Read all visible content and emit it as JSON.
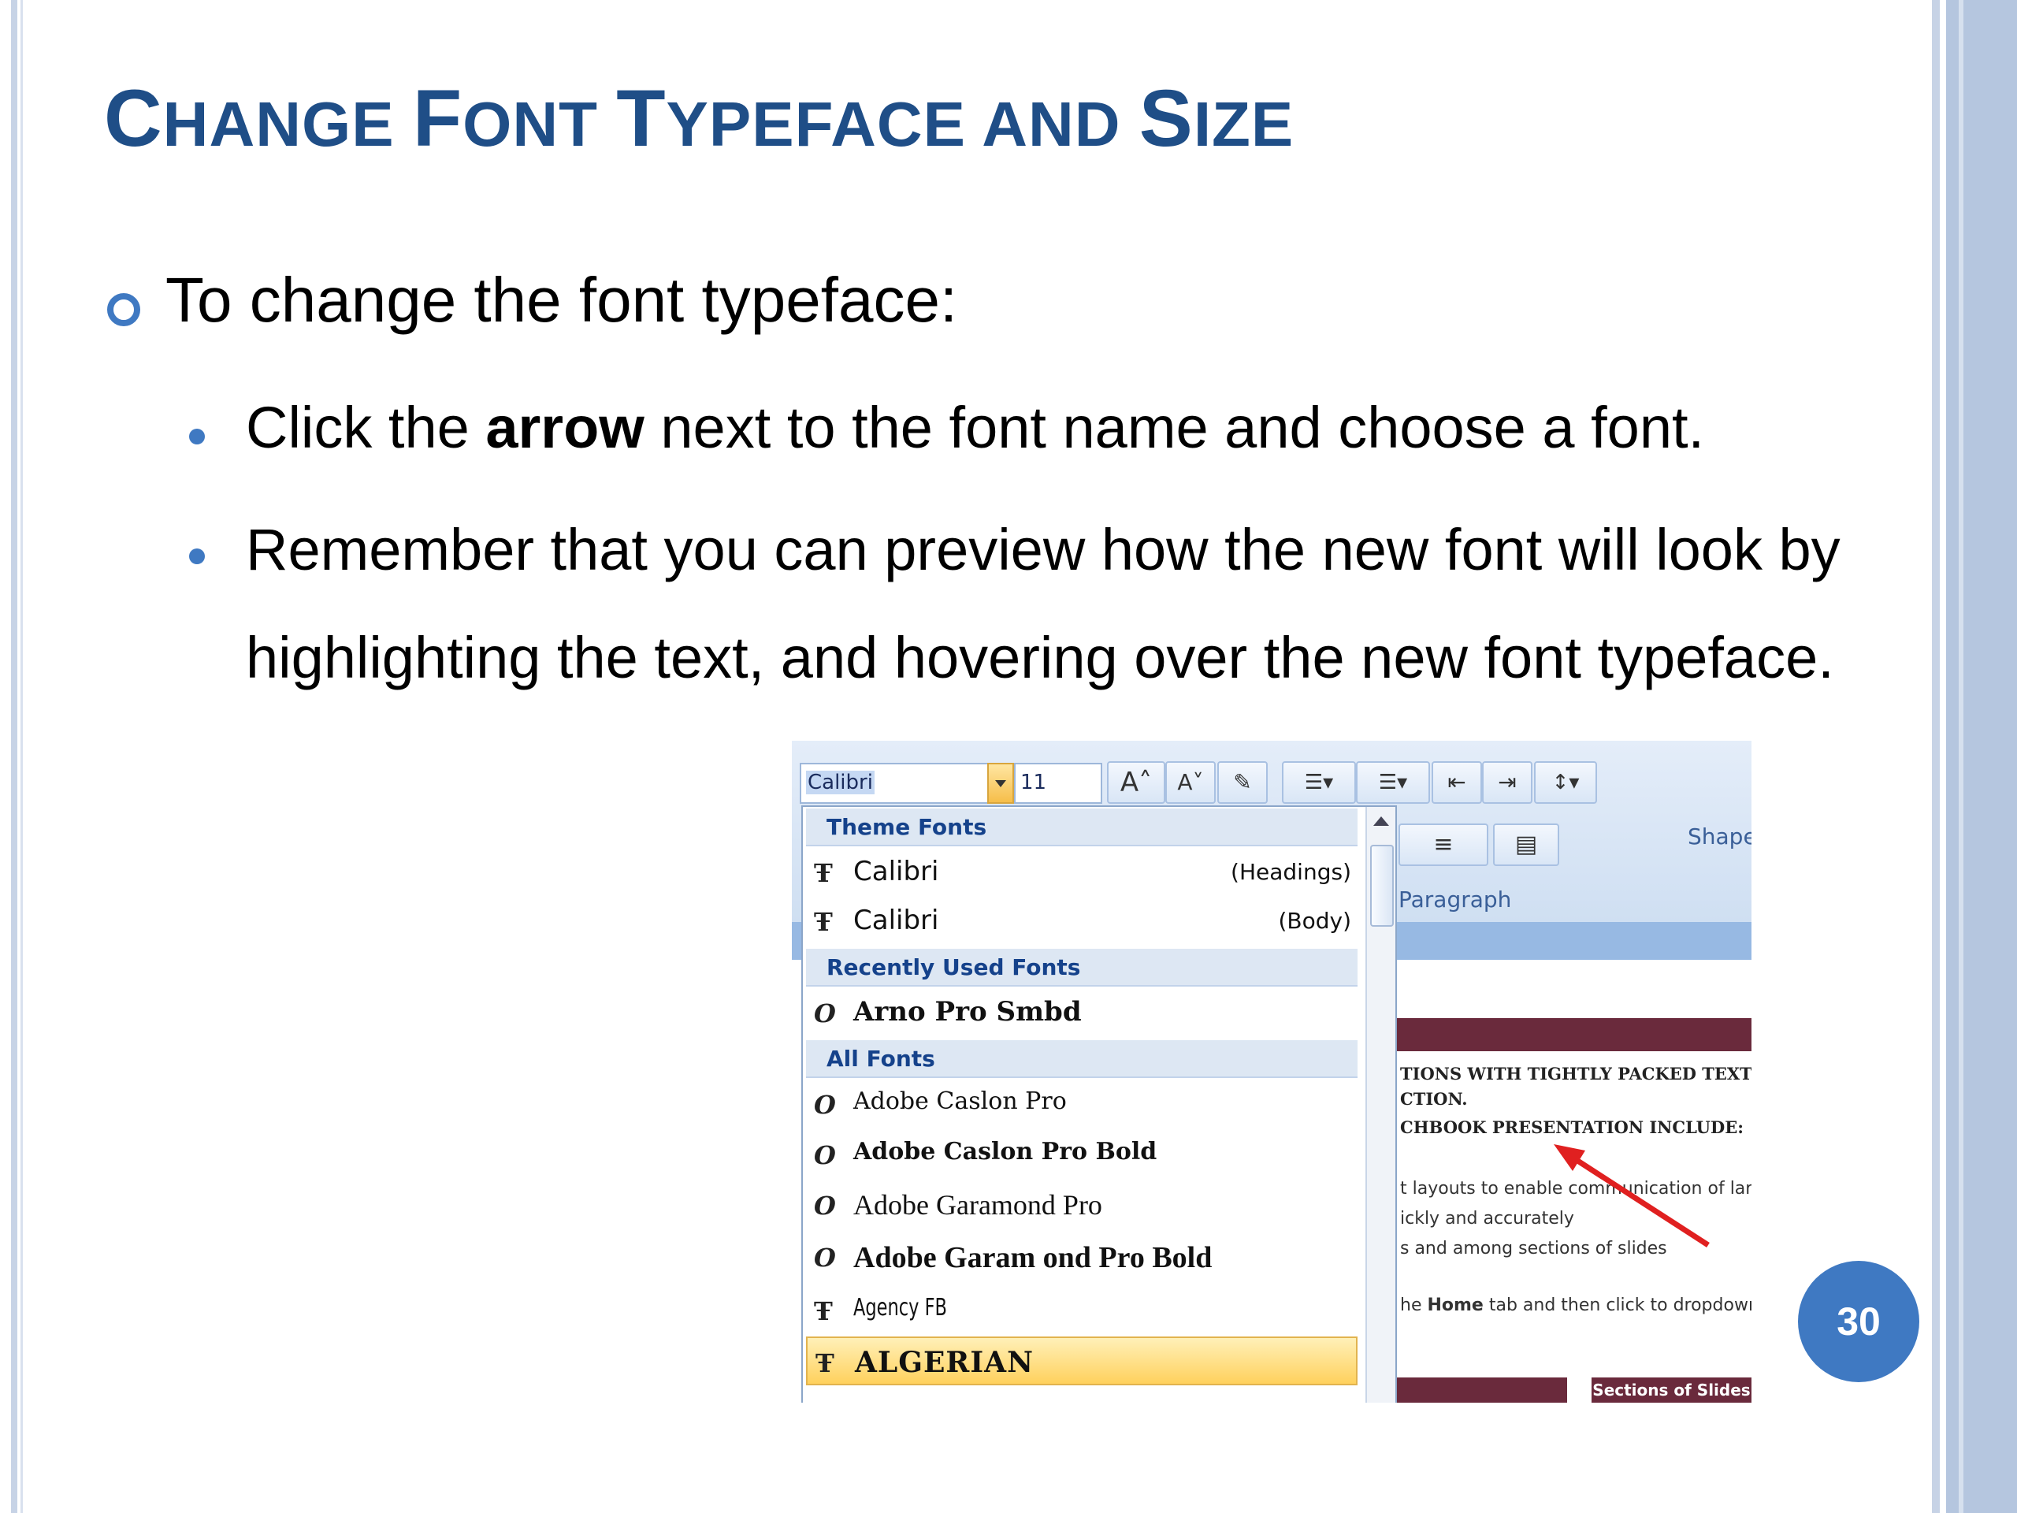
{
  "slide": {
    "title_parts": [
      {
        "text": "C",
        "size": "big"
      },
      {
        "text": "HANGE ",
        "size": "sm"
      },
      {
        "text": "F",
        "size": "big"
      },
      {
        "text": "ONT ",
        "size": "sm"
      },
      {
        "text": "T",
        "size": "big"
      },
      {
        "text": "YPEFACE AND  ",
        "size": "sm"
      },
      {
        "text": "S",
        "size": "big"
      },
      {
        "text": "IZE",
        "size": "sm"
      }
    ],
    "bullet1": "To change the font typeface:",
    "bullet2_pre": "Click the ",
    "bullet2_bold": "arrow",
    "bullet2_post": " next to the font name and choose a  font.",
    "bullet3_line1": "Remember that you can preview how the new font will  look by",
    "bullet3_line2": "highlighting the text, and hovering over the new  font typeface.",
    "page_number": "30"
  },
  "screenshot": {
    "font_name": "Calibri",
    "font_size": "11",
    "ribbon_buttons": [
      "A˄",
      "A˅",
      "✎",
      "☰▾",
      "☰▾",
      "⇤",
      "⇥",
      "↕▾",
      "≡",
      "▤"
    ],
    "paragraph_label": "Paragraph",
    "shape_label": "Shape",
    "dropdown": {
      "theme_header": "Theme Fonts",
      "theme_fonts": [
        {
          "name": "Calibri",
          "tag": "(Headings)"
        },
        {
          "name": "Calibri",
          "tag": "(Body)"
        }
      ],
      "recent_header": "Recently Used Fonts",
      "recent_fonts": [
        {
          "name": "Arno Pro Smbd"
        }
      ],
      "all_header": "All Fonts",
      "all_fonts": [
        {
          "name": "Adobe Caslon Pro"
        },
        {
          "name": "Adobe Caslon Pro Bold"
        },
        {
          "name": "Adobe Garamond Pro"
        },
        {
          "name": "Adobe Garam ond Pro Bold"
        },
        {
          "name": "Agency FB"
        },
        {
          "name": "ALGERIAN"
        }
      ]
    },
    "doc_text": {
      "line1": "TIONS WITH TIGHTLY PACKED TEXT A",
      "line2": "CTION.",
      "line3": "CHBOOK PRESENTATION INCLUDE:",
      "line4": "t  layouts to enable communication  of lar",
      "line5": "ickly and accurately",
      "line6": "s and among sections of slides",
      "line7_pre": "he ",
      "line7_bold": "Home",
      "line7_post": " tab and then click to dropdown",
      "footer_label": "Sections of Slides"
    }
  },
  "colors": {
    "title": "#1f4e87",
    "accent": "#3f79c2",
    "arrow": "#e02020"
  }
}
